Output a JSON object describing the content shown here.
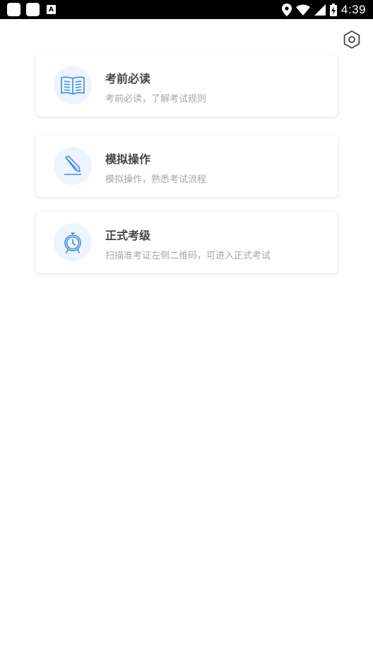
{
  "status_bar": {
    "time": "4:39",
    "notification_badge": "A"
  },
  "cards": [
    {
      "title": "考前必读",
      "description": "考前必读，了解考试规则",
      "icon": "book-icon"
    },
    {
      "title": "模拟操作",
      "description": "模拟操作，熟悉考试流程",
      "icon": "pencil-icon"
    },
    {
      "title": "正式考级",
      "description": "扫描准考证左侧二维码，可进入正式考试",
      "icon": "alarm-clock-icon"
    }
  ],
  "colors": {
    "accent": "#3d8fe0",
    "icon_bg": "#eef4fd",
    "title": "#444444",
    "description": "#a6a6a6"
  }
}
